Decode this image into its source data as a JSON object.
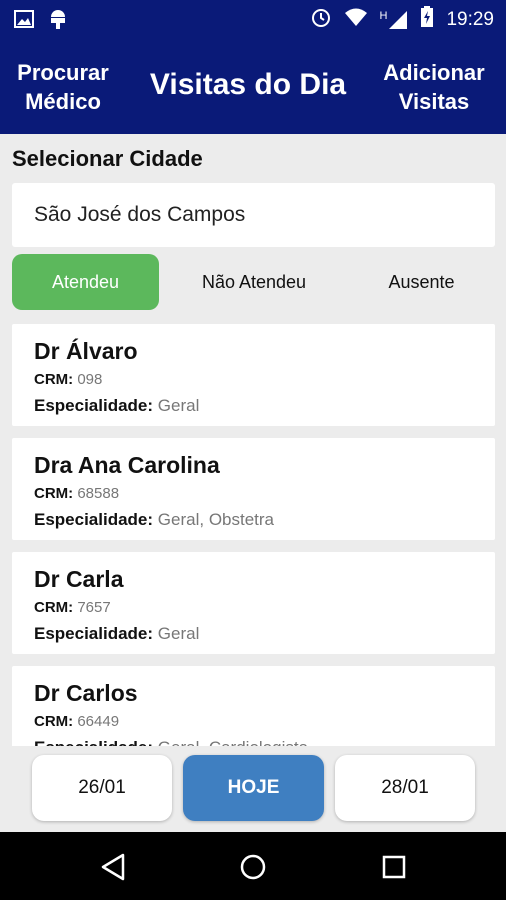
{
  "status_bar": {
    "time": "19:29",
    "icons_left": [
      "image-icon",
      "android-icon"
    ],
    "icons_right": [
      "alarm-icon",
      "wifi-icon",
      "signal-h-icon",
      "battery-charging-icon"
    ],
    "network_type": "H"
  },
  "app_bar": {
    "left_action_line1": "Procurar",
    "left_action_line2": "Médico",
    "title": "Visitas do Dia",
    "right_action_line1": "Adicionar",
    "right_action_line2": "Visitas"
  },
  "city": {
    "label": "Selecionar Cidade",
    "value": "São José dos Campos"
  },
  "tabs": [
    {
      "label": "Atendeu",
      "active": true
    },
    {
      "label": "Não Atendeu",
      "active": false
    },
    {
      "label": "Ausente",
      "active": false
    }
  ],
  "list": {
    "crm_label": "CRM:",
    "specialty_label": "Especialidade:",
    "doctors": [
      {
        "name": "Dr Álvaro",
        "crm": "098",
        "specialty": "Geral"
      },
      {
        "name": "Dra Ana Carolina",
        "crm": "68588",
        "specialty": "Geral, Obstetra"
      },
      {
        "name": "Dr Carla",
        "crm": "7657",
        "specialty": "Geral"
      },
      {
        "name": "Dr Carlos",
        "crm": "66449",
        "specialty": "Geral, Cardiologista"
      }
    ]
  },
  "day_nav": {
    "prev": "26/01",
    "today": "HOJE",
    "next": "28/01"
  },
  "colors": {
    "primary": "#0a1a78",
    "active_tab": "#5cb85c",
    "today_button": "#3f7fc1"
  }
}
